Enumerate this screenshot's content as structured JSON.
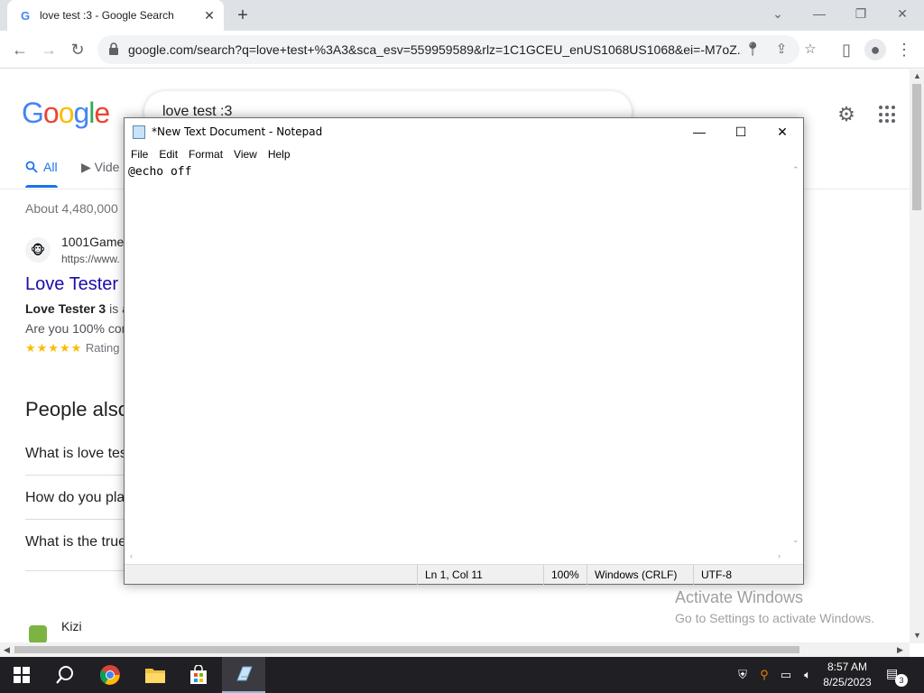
{
  "chrome": {
    "tab_title": "love test :3 - Google Search",
    "tab_favicon": "G",
    "url": "google.com/search?q=love+test+%3A3&sca_esv=559959589&rlz=1C1GCEU_enUS1068US1068&ei=-M7oZ..."
  },
  "google": {
    "query": "love test :3",
    "logo_letters": [
      "G",
      "o",
      "o",
      "g",
      "l",
      "e"
    ],
    "logo_colors": [
      "#4285f4",
      "#ea4335",
      "#fbbc05",
      "#4285f4",
      "#34a853",
      "#ea4335"
    ],
    "tab_all": "All",
    "tab_video": "Vide",
    "result_count": "About 4,480,000",
    "result1": {
      "site_name": "1001Game",
      "site_url": "https://www.",
      "title": "Love Tester",
      "snippet_bold": "Love Tester 3",
      "snippet_rest": " is a",
      "snippet2": "Are you 100% com",
      "stars": "★★★★★",
      "rating_label": "Rating"
    },
    "people_also_ask": "People also",
    "questions": [
      "What is love tes",
      "How do you pla",
      "What is the true"
    ],
    "result2_site": "Kizi"
  },
  "notepad": {
    "title": "*New Text Document - Notepad",
    "menus": [
      "File",
      "Edit",
      "Format",
      "View",
      "Help"
    ],
    "content": "@echo off",
    "status": {
      "position": "Ln 1, Col 11",
      "zoom": "100%",
      "line_ending": "Windows (CRLF)",
      "encoding": "UTF-8"
    }
  },
  "watermark": {
    "line1": "Activate Windows",
    "line2": "Go to Settings to activate Windows."
  },
  "taskbar": {
    "time": "8:57 AM",
    "date": "8/25/2023",
    "notification_count": "3"
  }
}
